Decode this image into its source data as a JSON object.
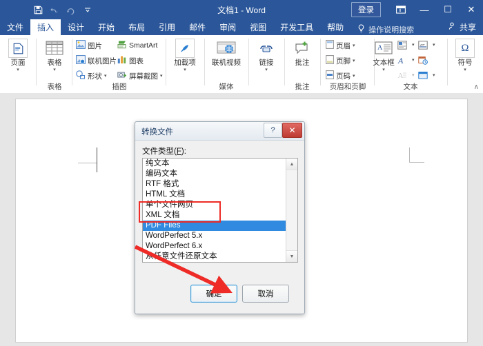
{
  "titlebar": {
    "quick_access": [
      {
        "name": "save-icon",
        "label": "ὋE"
      },
      {
        "name": "undo-icon",
        "label": "↶"
      },
      {
        "name": "redo-icon",
        "label": "↻"
      },
      {
        "name": "customize-qat-icon",
        "label": "▾"
      }
    ],
    "document_title": "文档1  -  Word",
    "sign_in": "登录",
    "ribbon_display_options": "ribbon-display-options-icon",
    "minimize": "—",
    "maximize": "☐",
    "close": "✕"
  },
  "tabs": [
    {
      "label": "文件",
      "active": false
    },
    {
      "label": "插入",
      "active": true
    },
    {
      "label": "设计",
      "active": false
    },
    {
      "label": "开始",
      "active": false
    },
    {
      "label": "布局",
      "active": false
    },
    {
      "label": "引用",
      "active": false
    },
    {
      "label": "邮件",
      "active": false
    },
    {
      "label": "审阅",
      "active": false
    },
    {
      "label": "视图",
      "active": false
    },
    {
      "label": "开发工具",
      "active": false
    },
    {
      "label": "帮助",
      "active": false
    }
  ],
  "tell_me": {
    "placeholder": "操作说明搜索"
  },
  "share": {
    "label": "共享"
  },
  "ribbon": {
    "groups": [
      {
        "name": "pages",
        "label": "",
        "big_button": {
          "label": "页面",
          "icon": "page-icon",
          "caret": "▾"
        }
      },
      {
        "name": "tables",
        "label": "表格",
        "big_button": {
          "label": "表格",
          "icon": "table-icon",
          "caret": "▾"
        }
      },
      {
        "name": "illustrations",
        "label": "插图",
        "items": [
          {
            "label": "图片",
            "icon": "picture-icon",
            "caret": ""
          },
          {
            "label": "SmartArt",
            "icon": "smartart-icon",
            "caret": ""
          },
          {
            "label": "联机图片",
            "icon": "online-picture-icon",
            "caret": ""
          },
          {
            "label": "图表",
            "icon": "chart-icon",
            "caret": ""
          },
          {
            "label": "形状",
            "icon": "shapes-icon",
            "caret": "▾"
          },
          {
            "label": "屏幕截图",
            "icon": "screenshot-icon",
            "caret": "▾"
          }
        ]
      },
      {
        "name": "addins",
        "label": "",
        "big_button": {
          "label": "加载项",
          "icon": "addins-icon",
          "caret": "▾"
        }
      },
      {
        "name": "media",
        "label": "媒体",
        "big_button": {
          "label": "联机视频",
          "icon": "online-video-icon",
          "caret": ""
        }
      },
      {
        "name": "links",
        "label": "",
        "big_button": {
          "label": "链接",
          "icon": "link-icon",
          "caret": "▾"
        }
      },
      {
        "name": "comments",
        "label": "批注",
        "big_button": {
          "label": "批注",
          "icon": "new-comment-icon",
          "caret": ""
        }
      },
      {
        "name": "header-footer",
        "label": "页眉和页脚",
        "items": [
          {
            "label": "页眉",
            "icon": "header-icon",
            "caret": "▾"
          },
          {
            "label": "页脚",
            "icon": "footer-icon",
            "caret": "▾"
          },
          {
            "label": "页码",
            "icon": "page-number-icon",
            "caret": "▾"
          }
        ]
      },
      {
        "name": "text",
        "label": "文本",
        "big_button": {
          "label": "文本框",
          "icon": "text-box-icon",
          "caret": "▾"
        },
        "small_icons": [
          {
            "name": "quick-parts-icon",
            "caret": "▾"
          },
          {
            "name": "signature-line-icon",
            "caret": "▾"
          },
          {
            "name": "wordart-icon",
            "caret": "▾"
          },
          {
            "name": "date-time-icon",
            "caret": ""
          },
          {
            "name": "drop-cap-icon",
            "caret": "▾"
          },
          {
            "name": "object-icon",
            "caret": "▾"
          }
        ]
      },
      {
        "name": "symbols",
        "label": "",
        "big_button": {
          "label": "符号",
          "icon": "omega-symbol-icon",
          "caret": "▾"
        }
      }
    ],
    "collapse_caret": "∧"
  },
  "dialog": {
    "title": "转换文件",
    "help_label": "?",
    "close_label": "✕",
    "field_label_prefix": "文件类型(",
    "field_label_key": "F",
    "field_label_suffix": "):",
    "file_types": [
      "纯文本",
      "编码文本",
      "RTF 格式",
      "HTML 文档",
      "单个文件网页",
      "XML 文档",
      "PDF Files",
      "WordPerfect 5.x",
      "WordPerfect 6.x",
      "从任意文件还原文本"
    ],
    "selected_file_type": "PDF Files",
    "scroll_up": "▲",
    "scroll_down": "▼",
    "ok_label": "确定",
    "cancel_label": "取消"
  },
  "annotations": {
    "highlight_color": "#ee2b26",
    "arrow_color": "#ee2b26"
  },
  "colors": {
    "word_blue": "#2b579a",
    "selection_blue": "#2f8ae0",
    "page_white": "#ffffff",
    "workspace_gray": "#e6e6e6"
  }
}
